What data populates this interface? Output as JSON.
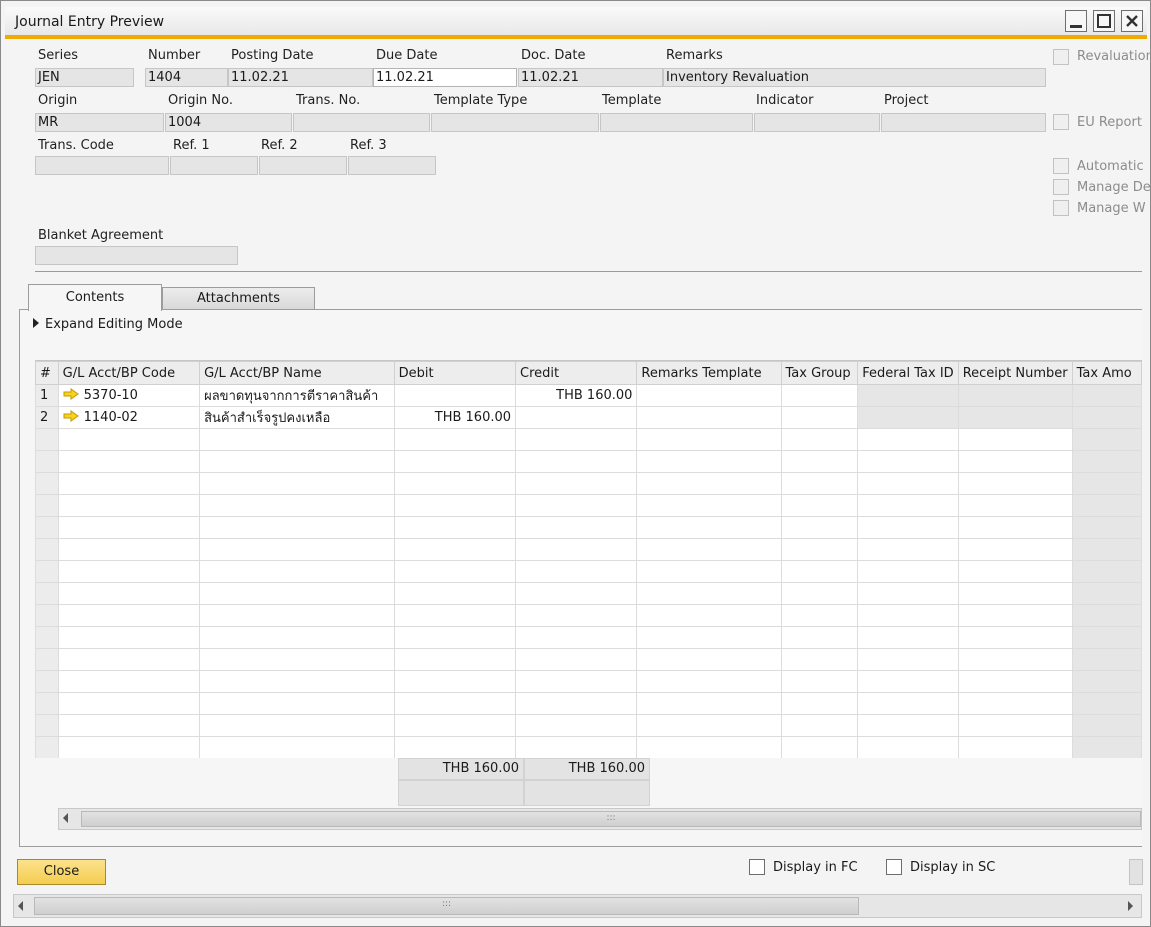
{
  "window": {
    "title": "Journal Entry Preview"
  },
  "header": {
    "series": {
      "label": "Series",
      "value": "JEN"
    },
    "number": {
      "label": "Number",
      "value": "1404"
    },
    "posting_date": {
      "label": "Posting Date",
      "value": "11.02.21"
    },
    "due_date": {
      "label": "Due Date",
      "value": "11.02.21"
    },
    "doc_date": {
      "label": "Doc. Date",
      "value": "11.02.21"
    },
    "remarks": {
      "label": "Remarks",
      "value": "Inventory Revaluation"
    },
    "origin": {
      "label": "Origin",
      "value": "MR"
    },
    "origin_no": {
      "label": "Origin No.",
      "value": "1004"
    },
    "trans_no": {
      "label": "Trans. No.",
      "value": ""
    },
    "template_type": {
      "label": "Template Type",
      "value": ""
    },
    "template": {
      "label": "Template",
      "value": ""
    },
    "indicator": {
      "label": "Indicator",
      "value": ""
    },
    "project": {
      "label": "Project",
      "value": ""
    },
    "trans_code": {
      "label": "Trans. Code",
      "value": ""
    },
    "ref1": {
      "label": "Ref. 1",
      "value": ""
    },
    "ref2": {
      "label": "Ref. 2",
      "value": ""
    },
    "ref3": {
      "label": "Ref. 3",
      "value": ""
    },
    "blanket_agreement": {
      "label": "Blanket Agreement",
      "value": ""
    }
  },
  "side_checkboxes": {
    "revaluation": "Revaluation",
    "eu_report": "EU Report",
    "automatic": "Automatic",
    "manage_de": "Manage De",
    "manage_w": "Manage W"
  },
  "tabs": {
    "contents": "Contents",
    "attachments": "Attachments"
  },
  "expand_editing_mode": "Expand Editing Mode",
  "grid": {
    "columns": [
      "#",
      "G/L Acct/BP Code",
      "G/L Acct/BP Name",
      "Debit",
      "Credit",
      "Remarks Template",
      "Tax Group",
      "Federal Tax ID",
      "Receipt Number",
      "Tax Amo"
    ],
    "rows": [
      {
        "num": "1",
        "code": "5370-10",
        "name": "ผลขาดทุนจากการตีราคาสินค้า",
        "debit": "",
        "credit": "THB 160.00"
      },
      {
        "num": "2",
        "code": "1140-02",
        "name": "สินค้าสำเร็จรูปคงเหลือ",
        "debit": "THB 160.00",
        "credit": ""
      }
    ],
    "total_debit": "THB 160.00",
    "total_credit": "THB 160.00"
  },
  "footer": {
    "close_label": "Close",
    "display_in_fc": "Display in FC",
    "display_in_sc": "Display in SC"
  },
  "colors": {
    "accent": "#f0ab00",
    "close_button": "#f4cd4f"
  }
}
